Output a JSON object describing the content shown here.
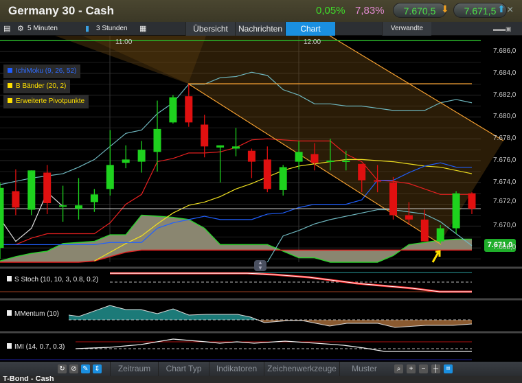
{
  "header": {
    "title": "Germany 30 - Cash",
    "change_pct": "0,05%",
    "range_pct": "7,83%",
    "sell": "7.670,5",
    "buy": "7.671,5",
    "close": "×"
  },
  "toolbar": {
    "interval": "5 Minuten",
    "period": "3 Stunden",
    "tabs": [
      "Übersicht",
      "Nachrichten",
      "Chart"
    ],
    "active_tab": "Chart",
    "related": "Verwandte"
  },
  "legend": [
    {
      "label": "IchiMoku (9, 26, 52)",
      "color": "#1e5cff"
    },
    {
      "label": "B Bänder (20, 2)",
      "color": "#ffe000"
    },
    {
      "label": "Erweiterte Pivotpunkte",
      "color": "#ffe000"
    }
  ],
  "time_labels": [
    "11:00",
    "12:00"
  ],
  "price_labels": [
    "7.686,0",
    "7.684,0",
    "7.682,0",
    "7.680,0",
    "7.678,0",
    "7.676,0",
    "7.674,0",
    "7.672,0",
    "7.670,0",
    "7.668,0"
  ],
  "current_price": "7.671,0",
  "subpanels": {
    "stoch": "S Stoch (10, 10, 3, 0.8, 0.2)",
    "momentum": "MMentum (10)",
    "imi": "IMI (14, 0.7, 0.3)"
  },
  "bottom": {
    "tabs": [
      "Zeitraum",
      "Chart Typ",
      "Indikatoren",
      "Zeichenwerkzeuge",
      "Muster"
    ]
  },
  "next_instrument": "T-Bond - Cash",
  "chart_data": {
    "type": "candlestick",
    "ylim": [
      7666,
      7687
    ],
    "current": 7671.0,
    "pivot_line": 7683.0,
    "candles": [
      [
        7668,
        7674,
        7667,
        7673.5
      ],
      [
        7673.2,
        7675.2,
        7671,
        7671.7
      ],
      [
        7671.5,
        7675.1,
        7671,
        7675.1
      ],
      [
        7674.9,
        7675.6,
        7671.1,
        7672.1
      ],
      [
        7671.8,
        7673.7,
        7670.4,
        7671.9
      ],
      [
        7671.6,
        7674.4,
        7670.6,
        7671.9
      ],
      [
        7672.2,
        7673.4,
        7671.3,
        7672.9
      ],
      [
        7673.4,
        7678.8,
        7672.8,
        7675.6
      ],
      [
        7675.8,
        7677.4,
        7675.3,
        7676.1
      ],
      [
        7675.9,
        7677.8,
        7674.9,
        7677
      ],
      [
        7676.8,
        7681.5,
        7675,
        7678.9
      ],
      [
        7679.5,
        7682,
        7679.4,
        7681.8
      ],
      [
        7681.9,
        7683,
        7679.1,
        7679.5
      ],
      [
        7679.3,
        7680.2,
        7676.3,
        7677.3
      ],
      [
        7677.2,
        7677.4,
        7674,
        7677.4
      ],
      [
        7677.1,
        7679,
        7676.4,
        7677.3
      ],
      [
        7676.9,
        7677.1,
        7674.4,
        7675.9
      ],
      [
        7676.1,
        7677.3,
        7673.1,
        7673.4
      ],
      [
        7673.3,
        7675.6,
        7672.8,
        7675.4
      ],
      [
        7675.9,
        7677.8,
        7675.2,
        7676.8
      ],
      [
        7676.6,
        7677.6,
        7675.1,
        7675.8
      ],
      [
        7675.9,
        7678,
        7675.1,
        7676
      ],
      [
        7675.9,
        7676.9,
        7675.1,
        7676
      ],
      [
        7675.7,
        7675.7,
        7673.1,
        7674.2
      ],
      [
        7674.2,
        7675.6,
        7673.1,
        7674.1
      ],
      [
        7674,
        7674.5,
        7670.6,
        7671
      ],
      [
        7671,
        7672.2,
        7670.1,
        7670.6
      ],
      [
        7670.6,
        7671.5,
        7668.6,
        7668.6
      ],
      [
        7668.6,
        7670.1,
        7668.4,
        7669.8
      ],
      [
        7669.8,
        7673.2,
        7669.3,
        7673
      ],
      [
        7673,
        7673.1,
        7671.1,
        7671.6
      ]
    ],
    "series": {
      "bb_upper": [
        7673.8,
        7674.1,
        7674.4,
        7674.6,
        7674.8,
        7675.4,
        7676.1,
        7677.3,
        7678.5,
        7678.8,
        7680.3,
        7681.3,
        7683,
        7683,
        7683.6,
        7683.7,
        7684.1,
        7683.8,
        7682.5,
        7682,
        7681.2,
        7681.2,
        7681,
        7681,
        7680.8,
        7680.6,
        7680.6,
        7680.6,
        7681.3,
        7681.6,
        7681.3
      ],
      "bb_lower": [
        null,
        null,
        null,
        null,
        null,
        null,
        null,
        null,
        null,
        null,
        null,
        null,
        null,
        null,
        null,
        null,
        null,
        7665.9,
        7669.1,
        7669.6,
        7670.2,
        7670.6,
        7670.9,
        7671.2,
        7671.5,
        7671.5,
        7671.3,
        7671.1,
        7670.4,
        7669.3,
        7668.2
      ],
      "red": [
        7668.3,
        7668.3,
        7668.9,
        7669.3,
        7669.3,
        7669.3,
        7669.3,
        7670.3,
        7672,
        7672.9,
        7675.9,
        7676.2,
        7676.7,
        7676.7,
        7676.8,
        7677.2,
        7677.9,
        7678,
        7677.9,
        7677.8,
        7677.8,
        7677.8,
        7676.6,
        7675.9,
        7674.2,
        7674.1,
        7673.9,
        7673.4,
        7672.9,
        7672.9,
        7672.9
      ],
      "yellow": [
        null,
        null,
        null,
        null,
        null,
        null,
        7666.8,
        7667.6,
        7668.4,
        7669.1,
        7670.2,
        7671.2,
        7671.9,
        7672.2,
        7672.7,
        7673.4,
        7673.9,
        7674.5,
        7675.1,
        7675.5,
        7675.7,
        7675.9,
        7676.1,
        7676.1,
        7676,
        7675.9,
        7675.7,
        7675.5,
        7675.4,
        7675.1,
        7674.8
      ],
      "blue": [
        7668.3,
        7668.3,
        7668.3,
        7668.3,
        7668.3,
        7668.3,
        7668.3,
        7668.5,
        7668.5,
        7668.5,
        7669.8,
        7670.3,
        7670.6,
        7670.9,
        7670.6,
        7670.6,
        7670.6,
        7671.1,
        7671.2,
        7671.7,
        7672,
        7672,
        7672,
        7672.4,
        7674.2,
        7674.2,
        7674.9,
        7675.5,
        7675.8,
        7675.4,
        7675.4
      ],
      "white": [
        7670.7,
        7668.6,
        7669.8,
        7673.1,
        7671.8
      ],
      "span_a": [
        7666.8,
        7667.2,
        7667.5,
        7667.7,
        7668.4,
        7668.5,
        7668.6,
        7669.2,
        7669.2,
        7671,
        7670.9,
        7670.8,
        7670.6,
        7669.8,
        7668.3,
        7668.3,
        7668.3,
        7668.3,
        7667.7,
        7667.1,
        7667.1,
        7666.4,
        7666.4,
        7666.4,
        7666.4,
        7667.3,
        7668.3,
        7668.5,
        7668.7,
        7668.8,
        7668.8
      ],
      "span_b": [
        7665.6,
        7665.8,
        7666,
        7666.2,
        7666.4,
        7666.6,
        7666.8,
        7667.2,
        7667.6,
        7667.8,
        7667.8,
        7667.8,
        7667.8,
        7667.8,
        7667.8,
        7667.8,
        7667.8,
        7667.8,
        7667.8,
        7667.8,
        7667.8,
        7667.8,
        7667.8,
        7667.8,
        7667.8,
        7667.8,
        7667.8,
        7667.8,
        7667.8,
        7667.8,
        7667.8
      ]
    },
    "stoch": [
      96,
      96,
      96,
      89,
      75,
      43,
      18,
      0,
      0,
      7
    ],
    "momentum": [
      3.5,
      2.5,
      10.5,
      7.5,
      7.5,
      4.5,
      8,
      3.5,
      4,
      4,
      2,
      -2,
      -0.5,
      -0.5,
      -4.5,
      -2.5,
      -2.5,
      -5.5,
      -4,
      -4,
      -3
    ],
    "imi": [
      50,
      54,
      62,
      78,
      70,
      66,
      70,
      66,
      72,
      66,
      60,
      52,
      42,
      42,
      42
    ]
  }
}
